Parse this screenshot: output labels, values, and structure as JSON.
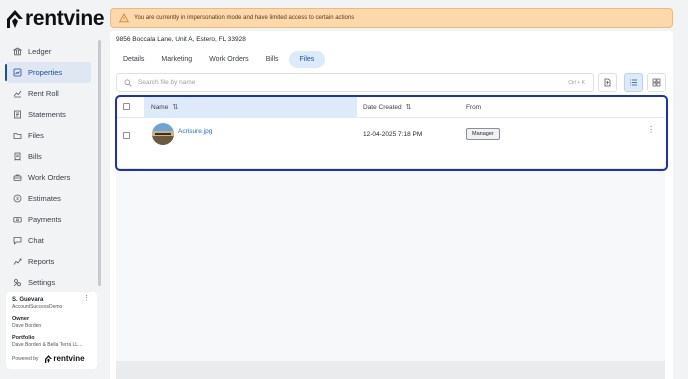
{
  "app": {
    "brand": "rentvine"
  },
  "sidebar": {
    "items": [
      {
        "label": "Ledger",
        "icon": "bank-icon",
        "active": false
      },
      {
        "label": "Properties",
        "icon": "home-chart-icon",
        "active": true
      },
      {
        "label": "Rent Roll",
        "icon": "trend-icon",
        "active": false
      },
      {
        "label": "Statements",
        "icon": "list-icon",
        "active": false
      },
      {
        "label": "Files",
        "icon": "folder-icon",
        "active": false
      },
      {
        "label": "Bills",
        "icon": "receipt-icon",
        "active": false
      },
      {
        "label": "Work Orders",
        "icon": "toolbox-icon",
        "active": false
      },
      {
        "label": "Estimates",
        "icon": "dollar-icon",
        "active": false
      },
      {
        "label": "Payments",
        "icon": "cash-icon",
        "active": false
      },
      {
        "label": "Chat",
        "icon": "chat-icon",
        "active": false
      },
      {
        "label": "Reports",
        "icon": "chart-icon",
        "active": false
      },
      {
        "label": "Settings",
        "icon": "settings-icon",
        "active": false
      }
    ]
  },
  "user": {
    "name": "S. Guevara",
    "account": "AccountSuccessDemo",
    "owner_label": "Owner",
    "owner_value": "Dave Borden",
    "portfolio_label": "Portfolio",
    "portfolio_value": "Dave Borden & Bella Terra LL...",
    "powered_by": "Powered by",
    "powered_brand": "rentvine"
  },
  "banner": {
    "text": "You are currently in impersonation mode and have limited access to certain actions"
  },
  "property": {
    "address": "9856 Boccala Lane, Unit A, Estero, FL 33928"
  },
  "tabs": [
    {
      "label": "Details",
      "active": false
    },
    {
      "label": "Marketing",
      "active": false
    },
    {
      "label": "Work Orders",
      "active": false
    },
    {
      "label": "Bills",
      "active": false
    },
    {
      "label": "Files",
      "active": true
    }
  ],
  "search": {
    "placeholder": "Search file by name",
    "shortcut": "Ctrl + K"
  },
  "table": {
    "columns": {
      "name": "Name",
      "date": "Date Created",
      "from": "From"
    },
    "rows": [
      {
        "name": "Acrisure.jpg",
        "date": "12-04-2025 7:18 PM",
        "from": "Manager"
      }
    ]
  },
  "colors": {
    "accent": "#1a4f9c",
    "highlight": "#1b2fc2",
    "banner": "#fbd9ad"
  }
}
